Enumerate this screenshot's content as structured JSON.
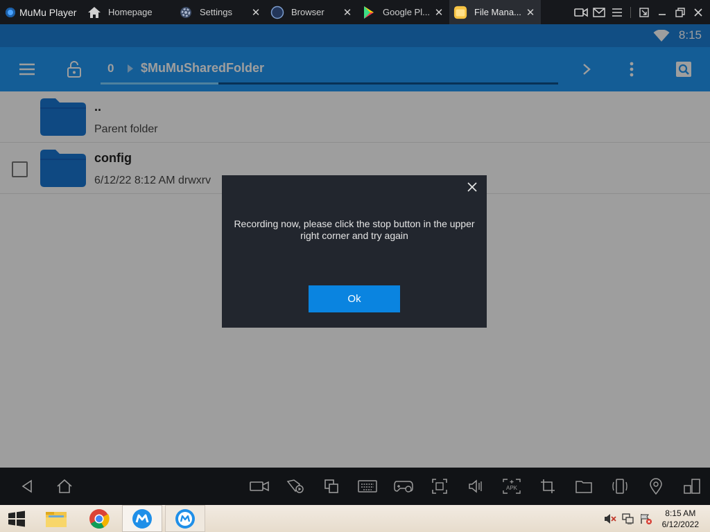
{
  "window": {
    "app_name": "MuMu Player",
    "tabs": [
      {
        "label": "Homepage",
        "closable": false,
        "icon": "home-icon"
      },
      {
        "label": "Settings",
        "closable": true,
        "icon": "gear-icon"
      },
      {
        "label": "Browser",
        "closable": true,
        "icon": "browser-icon"
      },
      {
        "label": "Google Pl...",
        "closable": true,
        "icon": "play-store-icon"
      },
      {
        "label": "File Mana...",
        "closable": true,
        "icon": "file-manager-icon",
        "active": true
      }
    ]
  },
  "android": {
    "status_time": "8:15",
    "breadcrumb": {
      "number": "0",
      "path": "$MuMuSharedFolder"
    },
    "files": [
      {
        "name": "..",
        "sub": "Parent folder",
        "checkbox": false
      },
      {
        "name": "config",
        "sub": "6/12/22 8:12 AM   drwxrv",
        "checkbox": true
      }
    ]
  },
  "dialog": {
    "message": "Recording now, please click the stop button in the upper right corner and try again",
    "ok_label": "Ok"
  },
  "taskbar": {
    "time": "8:15 AM",
    "date": "6/12/2022"
  },
  "colors": {
    "appbar": "#2196f3",
    "statusbar": "#1c7fd6",
    "folder": "#1976d2",
    "dialog_bg": "#22262e",
    "ok_button": "#0a84e0"
  }
}
